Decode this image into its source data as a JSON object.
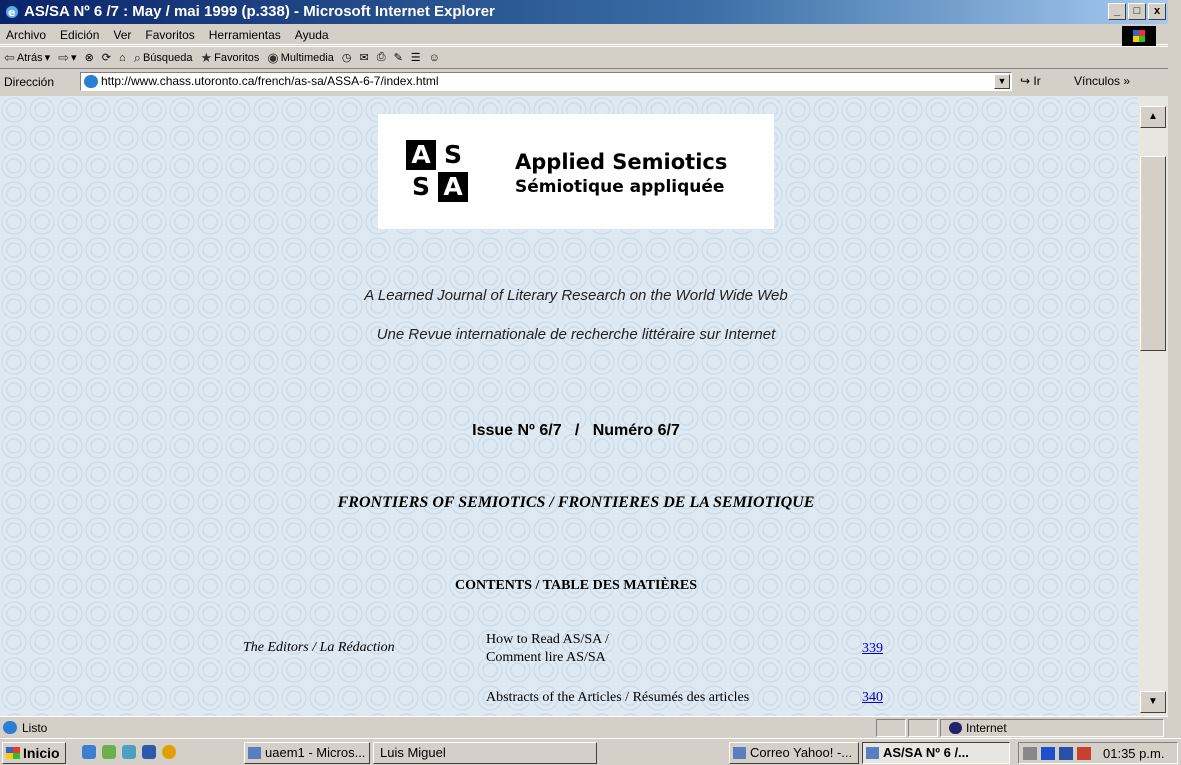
{
  "window": {
    "title": "AS/SA Nº 6 /7 : May / mai 1999 (p.338) - Microsoft Internet Explorer",
    "controls": [
      "_",
      "□",
      "x"
    ]
  },
  "menu": [
    "Archivo",
    "Edición",
    "Ver",
    "Favoritos",
    "Herramientas",
    "Ayuda"
  ],
  "toolbar": {
    "back": "Atrás",
    "search": "Búsqueda",
    "favorites": "Favoritos",
    "multimedia": "Multimedia"
  },
  "address": {
    "label": "Dirección",
    "url": "http://www.chass.utoronto.ca/french/as-sa/ASSA-6-7/index.html",
    "go": "Ir",
    "links": "Vínculos »"
  },
  "page": {
    "logo": {
      "mark": [
        "A",
        "S",
        "S",
        "A"
      ],
      "title_en": "Applied Semiotics",
      "title_fr": "Sémiotique appliquée"
    },
    "tagline_en": "A Learned Journal of Literary Research on the World Wide Web",
    "tagline_fr": "Une Revue internationale de recherche littéraire sur Internet",
    "issue": "Issue Nº 6/7   /   Numéro 6/7",
    "frontiers": "FRONTIERS OF SEMIOTICS / FRONTIERES DE LA SEMIOTIQUE",
    "contents_heading": "CONTENTS / TABLE DES MATIÈRES",
    "toc": [
      {
        "author": "The Editors / La Rédaction",
        "title_line1": "How to Read AS/SA /",
        "title_line2": "Comment lire AS/SA",
        "page": "339"
      },
      {
        "author": "",
        "title_line1": "Abstracts of the Articles / Résumés des articles",
        "title_line2": "",
        "page": "340"
      }
    ]
  },
  "status": {
    "text": "Listo",
    "zone": "Internet"
  },
  "taskbar": {
    "start": "Inicio",
    "tasks": [
      "uaem1 - Micros...",
      "Luis Miguel",
      "Correo Yahoo! -...",
      "AS/SA Nº 6 /..."
    ],
    "clock": "01:35 p.m."
  }
}
